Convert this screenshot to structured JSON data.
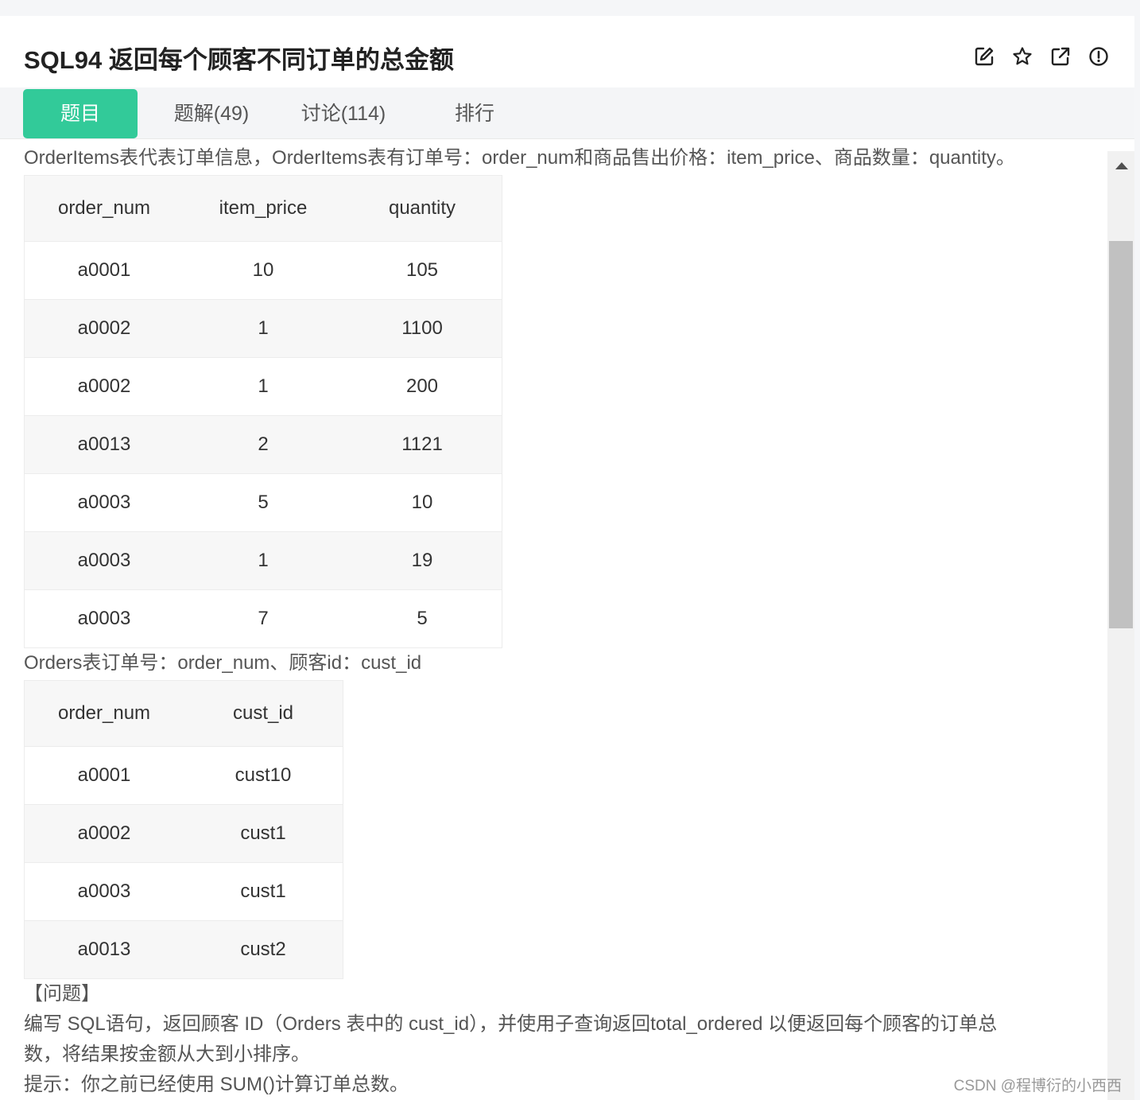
{
  "header": {
    "title": "SQL94  返回每个顾客不同订单的总金额",
    "icons": [
      "edit-icon",
      "star-icon",
      "external-link-icon",
      "info-icon"
    ]
  },
  "tabs": [
    {
      "label": "题目",
      "active": true
    },
    {
      "label": "题解(49)",
      "active": false
    },
    {
      "label": "讨论(114)",
      "active": false
    },
    {
      "label": "排行",
      "active": false
    }
  ],
  "content": {
    "intro1": "OrderItems表代表订单信息，OrderItems表有订单号：order_num和商品售出价格：item_price、商品数量：quantity。",
    "table1": {
      "headers": [
        "order_num",
        "item_price",
        "quantity"
      ],
      "rows": [
        [
          "a0001",
          "10",
          "105"
        ],
        [
          "a0002",
          "1",
          "1100"
        ],
        [
          "a0002",
          "1",
          "200"
        ],
        [
          "a0013",
          "2",
          "1121"
        ],
        [
          "a0003",
          "5",
          "10"
        ],
        [
          "a0003",
          "1",
          "19"
        ],
        [
          "a0003",
          "7",
          "5"
        ]
      ]
    },
    "intro2": "Orders表订单号：order_num、顾客id：cust_id",
    "table2": {
      "headers": [
        "order_num",
        "cust_id"
      ],
      "rows": [
        [
          "a0001",
          "cust10"
        ],
        [
          "a0002",
          "cust1"
        ],
        [
          "a0003",
          "cust1"
        ],
        [
          "a0013",
          "cust2"
        ]
      ]
    },
    "question_heading": "【问题】",
    "question_line1": "编写 SQL语句，返回顾客 ID（Orders 表中的 cust_id），并使用子查询返回total_ordered 以便返回每个顾客的订单总",
    "question_line2": "数，将结果按金额从大到小排序。",
    "hint": "提示：你之前已经使用 SUM()计算订单总数。"
  },
  "watermark": "CSDN @程博衍的小西西",
  "colors": {
    "accent": "#32ca99"
  }
}
